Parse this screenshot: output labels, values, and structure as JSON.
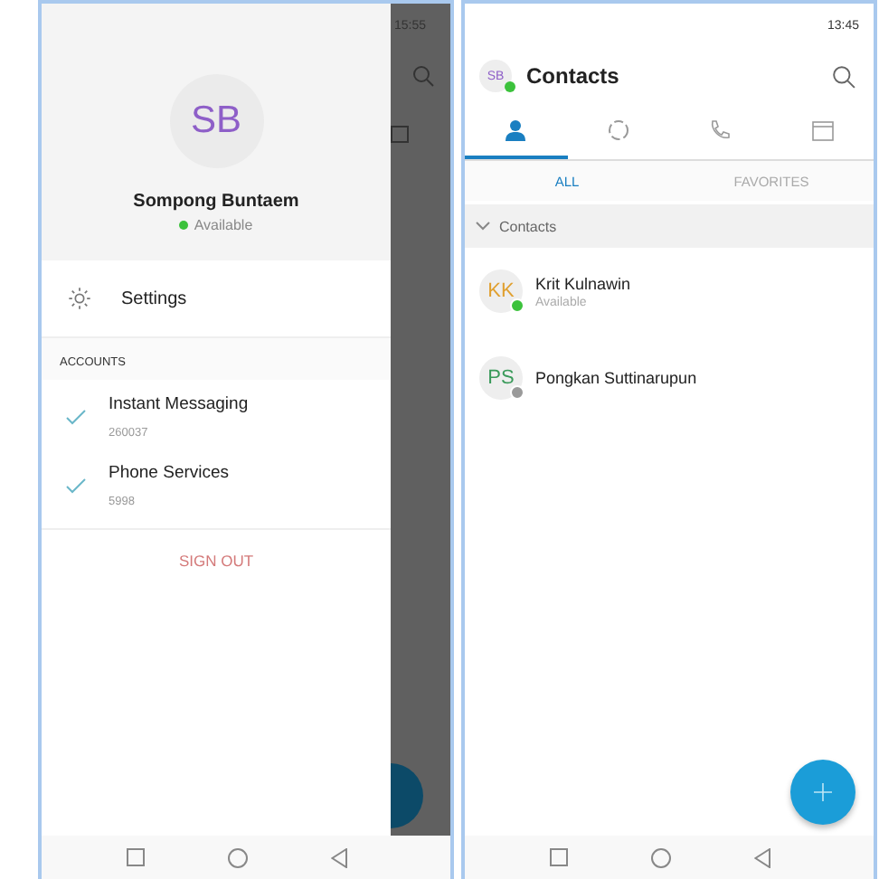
{
  "left_phone": {
    "status_bar": {
      "time": "15:55"
    },
    "profile": {
      "initials": "SB",
      "name": "Sompong Buntaem",
      "online": true,
      "presence_text": "Available"
    },
    "settings": {
      "label": "Settings"
    },
    "accounts_header": "ACCOUNTS",
    "accounts": [
      {
        "name": "Instant Messaging",
        "number": "260037",
        "checked": true
      },
      {
        "name": "Phone Services",
        "number": "5998",
        "checked": true
      }
    ],
    "sign_out": "SIGN OUT"
  },
  "right_phone": {
    "status_bar": {
      "time": "13:45"
    },
    "header": {
      "avatar_initials": "SB",
      "online": true,
      "title": "Contacts"
    },
    "tabs": [
      {
        "kind": "contacts",
        "selected": true
      },
      {
        "kind": "chats",
        "selected": false
      },
      {
        "kind": "calls",
        "selected": false
      },
      {
        "kind": "calendar",
        "selected": false
      }
    ],
    "subtabs": [
      {
        "label": "ALL",
        "selected": true
      },
      {
        "label": "FAVORITES",
        "selected": false
      }
    ],
    "group": {
      "label": "Contacts",
      "expanded": true
    },
    "contacts": [
      {
        "initials": "KK",
        "color": "#e0a030",
        "name": "Krit Kulnawin",
        "status_text": "Available",
        "online": true
      },
      {
        "initials": "PS",
        "color": "#3a9a5a",
        "name": "Pongkan Suttinarupun",
        "online": false
      }
    ]
  }
}
